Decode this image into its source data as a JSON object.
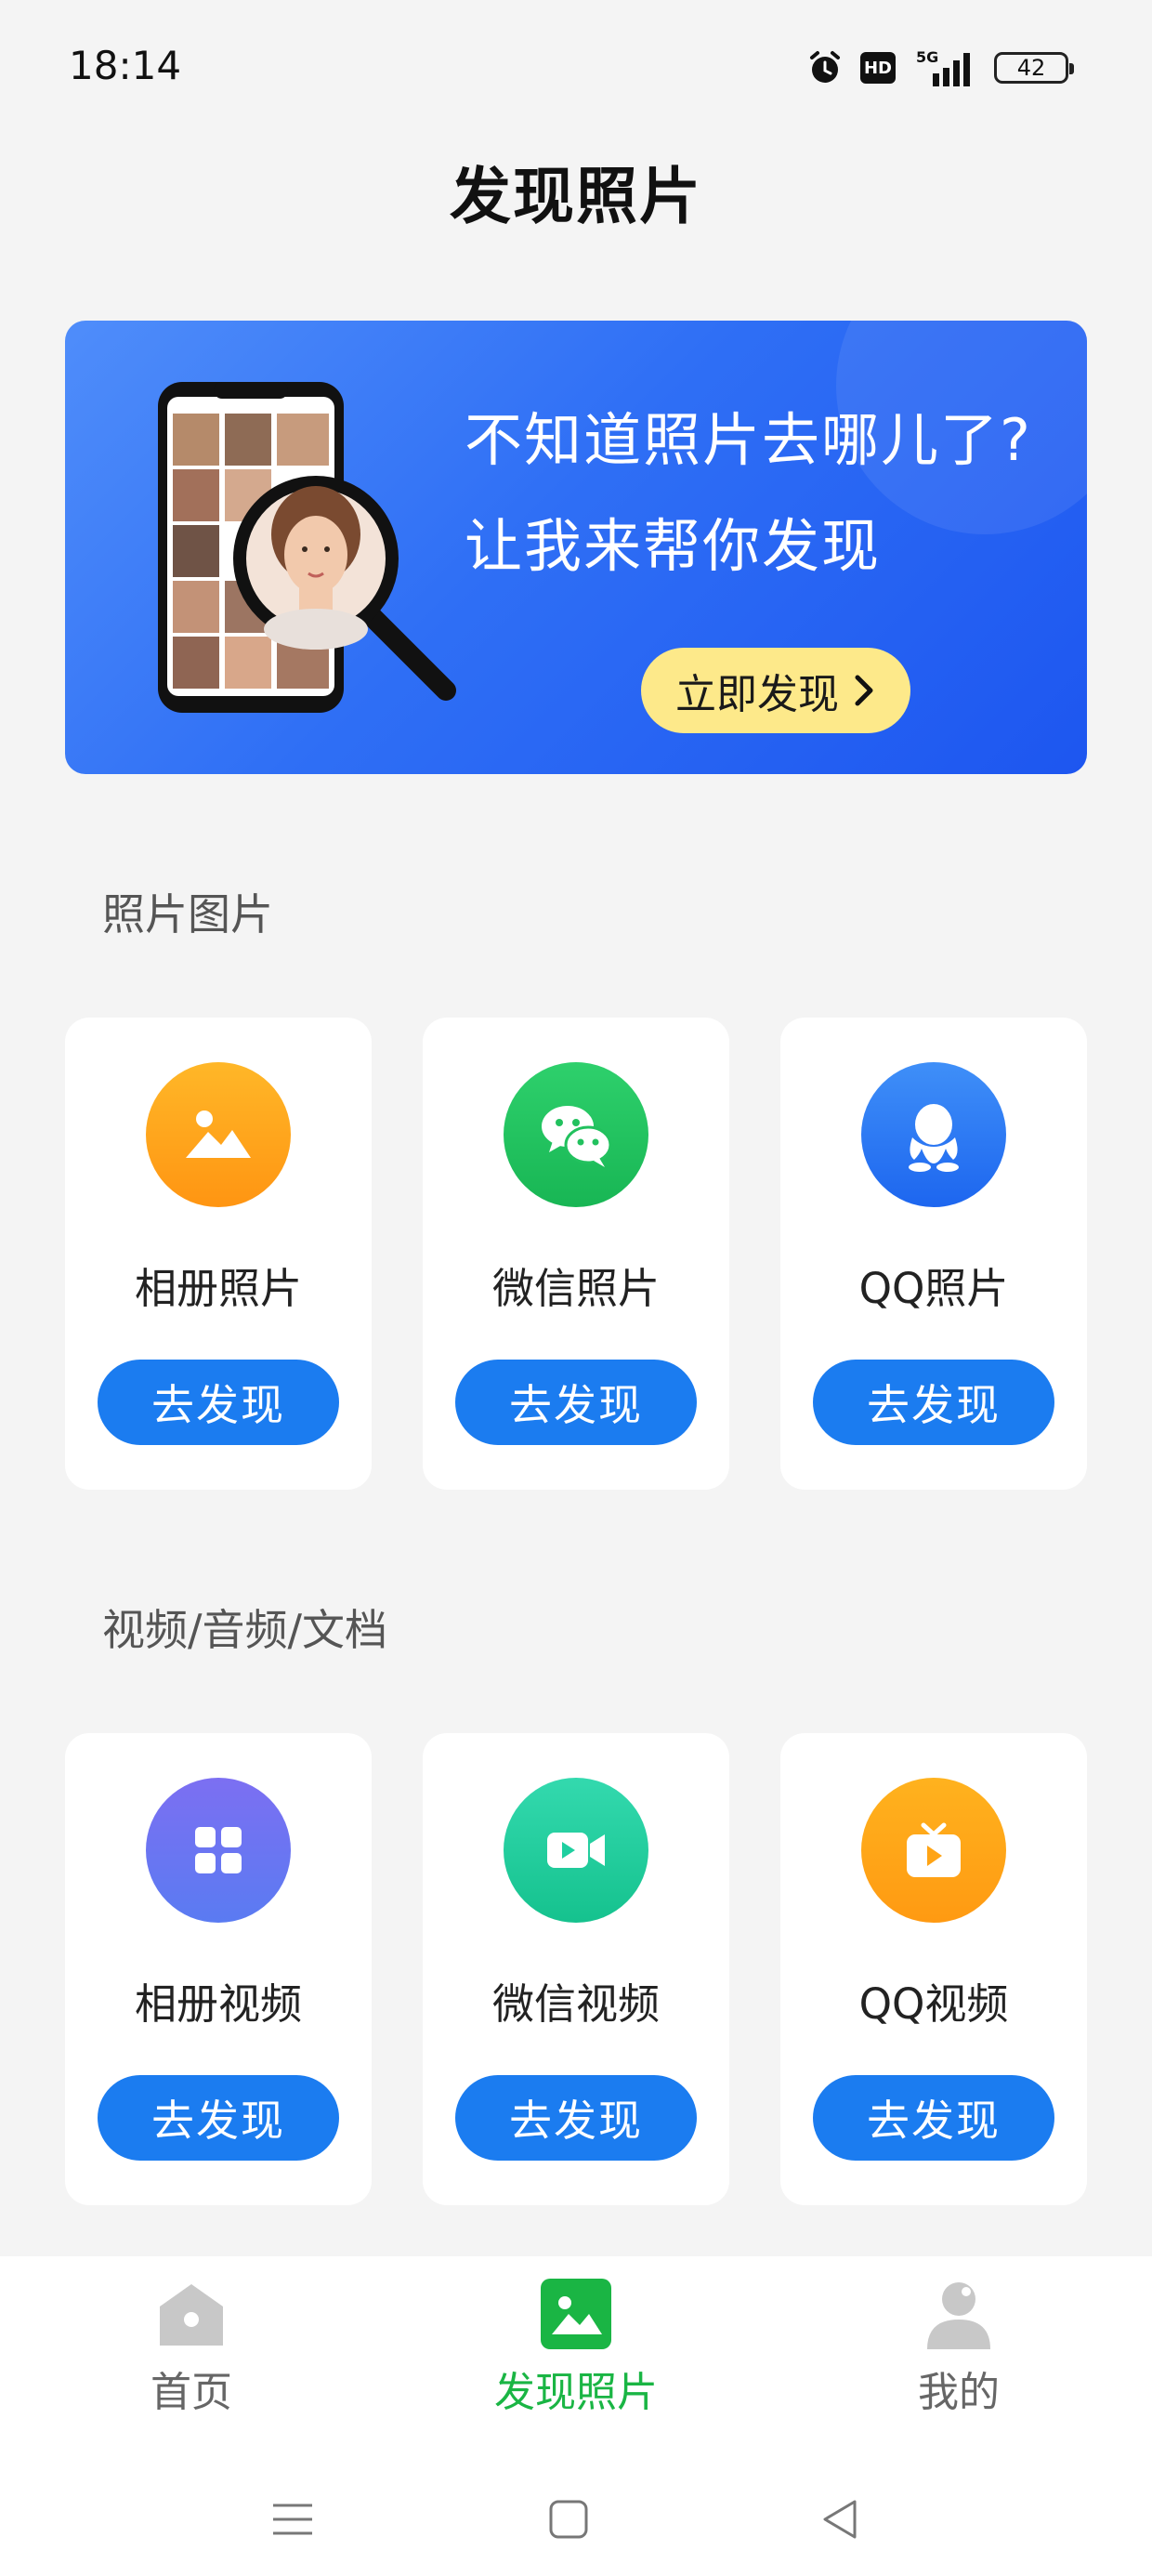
{
  "status_bar": {
    "time": "18:14",
    "hd_label": "HD",
    "network_label": "5G",
    "battery_level": "42"
  },
  "page": {
    "title": "发现照片"
  },
  "banner": {
    "line1": "不知道照片去哪儿了?",
    "line2": "让我来帮你发现",
    "cta_label": "立即发现"
  },
  "sections": [
    {
      "title": "照片图片",
      "cards": [
        {
          "label": "相册照片",
          "button": "去发现",
          "icon": "gallery-icon",
          "color": "#ffa415"
        },
        {
          "label": "微信照片",
          "button": "去发现",
          "icon": "wechat-icon",
          "color": "#22c15e"
        },
        {
          "label": "QQ照片",
          "button": "去发现",
          "icon": "qq-icon",
          "color": "#2d7cf6"
        }
      ]
    },
    {
      "title": "视频/音频/文档",
      "cards": [
        {
          "label": "相册视频",
          "button": "去发现",
          "icon": "grid-icon",
          "color": "#6a74f2"
        },
        {
          "label": "微信视频",
          "button": "去发现",
          "icon": "video-camera-icon",
          "color": "#1fcfa0"
        },
        {
          "label": "QQ视频",
          "button": "去发现",
          "icon": "tv-play-icon",
          "color": "#ffa415"
        }
      ]
    }
  ],
  "bottom_nav": {
    "items": [
      {
        "label": "首页",
        "icon": "home-icon",
        "active": false
      },
      {
        "label": "发现照片",
        "icon": "photo-icon",
        "active": true
      },
      {
        "label": "我的",
        "icon": "user-icon",
        "active": false
      }
    ],
    "active_color": "#1ab544"
  },
  "colors": {
    "accent_blue": "#1b7cf0",
    "banner_blue": "#2f6ff5",
    "cta_yellow": "#fde98a",
    "background": "#f4f4f4"
  }
}
